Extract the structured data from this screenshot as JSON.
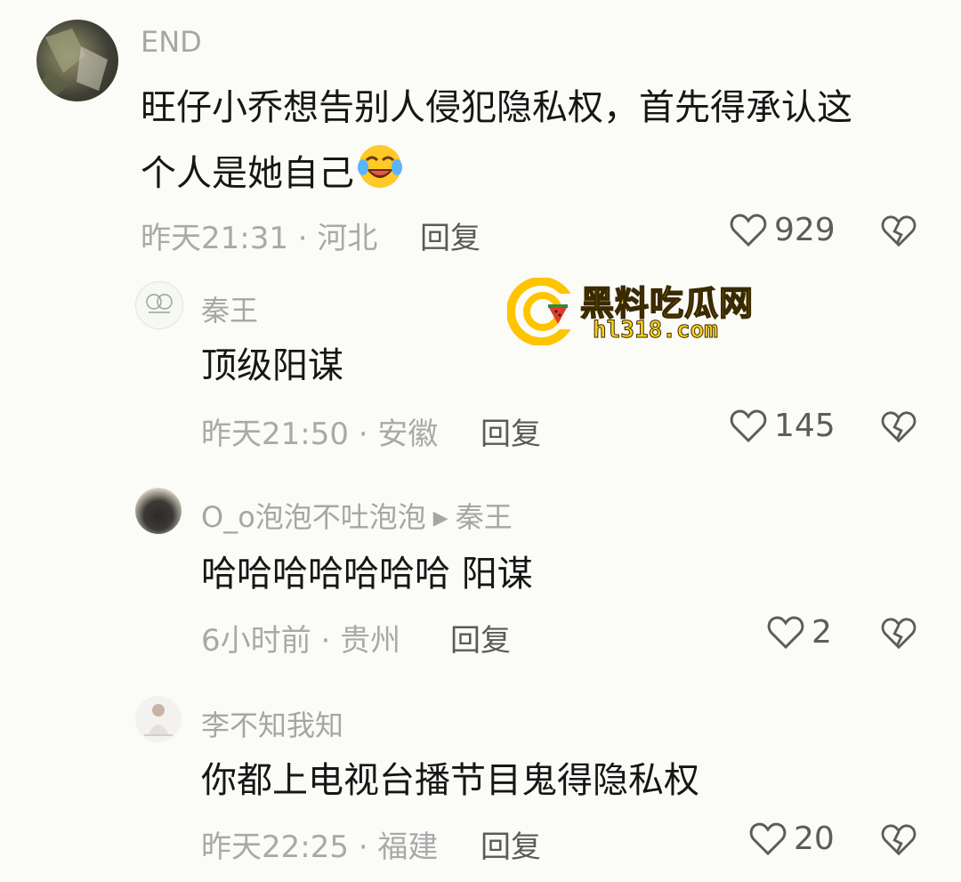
{
  "comments": [
    {
      "author": "END",
      "text_line1": "旺仔小乔想告别人侵犯隐私权，首先得承认这",
      "text_line2": "个人是她自己",
      "time": "昨天21:31",
      "location": "河北",
      "reply_label": "回复",
      "likes": "929"
    },
    {
      "author": "秦王",
      "text": "顶级阳谋",
      "time": "昨天21:50",
      "location": "安徽",
      "reply_label": "回复",
      "likes": "145"
    },
    {
      "author": "O_o泡泡不吐泡泡",
      "reply_to": "秦王",
      "text": "哈哈哈哈哈哈哈 阳谋",
      "time": "6小时前",
      "location": "贵州",
      "reply_label": "回复",
      "likes": "2"
    },
    {
      "author": "李不知我知",
      "text": "你都上电视台播节目鬼得隐私权",
      "time": "昨天22:25",
      "location": "福建",
      "reply_label": "回复",
      "likes": "20"
    }
  ],
  "separator": "·",
  "reply_arrow": "▶",
  "watermark": {
    "title": "黑料吃瓜网",
    "url": "hl318.com"
  },
  "colors": {
    "background": "#fbfbf8",
    "text": "#161616",
    "meta": "#a9a9a9",
    "watermark_yellow": "#ffd21a"
  },
  "icons": [
    "heart-icon",
    "broken-heart-icon",
    "laughing-emoji"
  ]
}
